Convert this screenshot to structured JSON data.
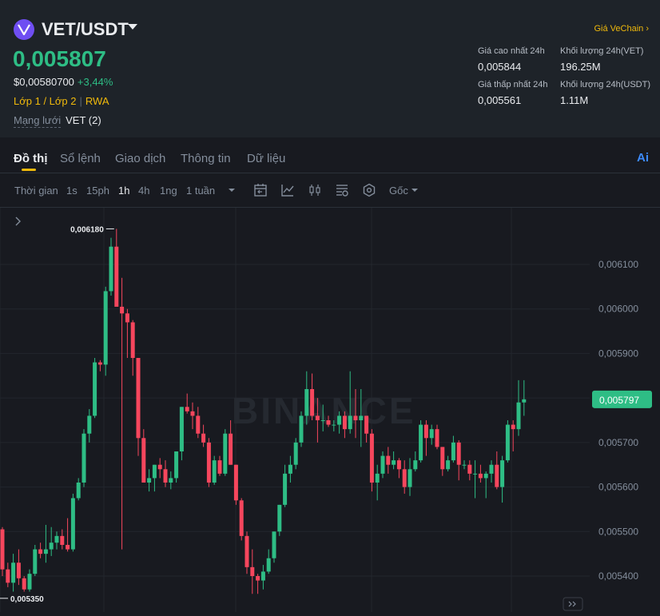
{
  "header": {
    "pair": "VET/USDT",
    "price": "0,005807",
    "usd_price": "$0,00580700",
    "change": "+3,44%",
    "tag1": "Lớp 1 / Lớp 2",
    "tag2": "RWA",
    "network_label": "Mạng lưới",
    "network_value": "VET (2)",
    "vechain_link": "Giá VeChain"
  },
  "stats": {
    "high_label": "Giá cao nhất 24h",
    "high_value": "0,005844",
    "low_label": "Giá thấp nhất 24h",
    "low_value": "0,005561",
    "vol_vet_label": "Khối lượng 24h(VET)",
    "vol_vet_value": "196.25M",
    "vol_usdt_label": "Khối lượng 24h(USDT)",
    "vol_usdt_value": "1.11M"
  },
  "tabs": [
    "Đồ thị",
    "Sổ lệnh",
    "Giao dịch",
    "Thông tin",
    "Dữ liệu"
  ],
  "ai_label": "Ai",
  "toolbar": {
    "time_label": "Thời gian",
    "intervals": [
      "1s",
      "15ph",
      "1h",
      "4h",
      "1ng",
      "1 tuần"
    ],
    "active_interval": "1h",
    "price_type": "Gốc"
  },
  "colors": {
    "up": "#2ebd85",
    "down": "#f6465d",
    "accent": "#f0b90b",
    "ai": "#3d8bfd"
  },
  "chart": {
    "watermark": "BINANCE",
    "y_ticks": [
      "0,006100",
      "0,006000",
      "0,005900",
      "0,005800",
      "0,005700",
      "0,005600",
      "0,005500",
      "0,005400"
    ],
    "y_tick_values": [
      0.0061,
      0.006,
      0.0059,
      0.0058,
      0.0057,
      0.0056,
      0.0055,
      0.0054
    ],
    "current_price": "0,005797",
    "current_value": 0.005797,
    "high_label": "0,006180",
    "low_label": "0,005350",
    "high_value": 0.00618,
    "low_value": 0.00535,
    "candles": [
      [
        0.005505,
        0.00551,
        0.0054,
        0.005415
      ],
      [
        0.005415,
        0.00543,
        0.005375,
        0.005385
      ],
      [
        0.005385,
        0.00545,
        0.005365,
        0.00543
      ],
      [
        0.00543,
        0.00546,
        0.00538,
        0.005395
      ],
      [
        0.005395,
        0.0054,
        0.005365,
        0.00537
      ],
      [
        0.00537,
        0.005415,
        0.005365,
        0.005405
      ],
      [
        0.005405,
        0.00547,
        0.0054,
        0.00546
      ],
      [
        0.00546,
        0.005475,
        0.00544,
        0.00545
      ],
      [
        0.00545,
        0.005515,
        0.00543,
        0.00546
      ],
      [
        0.00546,
        0.00551,
        0.005445,
        0.005475
      ],
      [
        0.005475,
        0.0055,
        0.00546,
        0.00549
      ],
      [
        0.00549,
        0.005505,
        0.00546,
        0.00547
      ],
      [
        0.00547,
        0.00553,
        0.005455,
        0.00546
      ],
      [
        0.00546,
        0.005585,
        0.005455,
        0.005575
      ],
      [
        0.005575,
        0.00562,
        0.00557,
        0.00561
      ],
      [
        0.00561,
        0.00573,
        0.0056,
        0.00572
      ],
      [
        0.00572,
        0.005775,
        0.0057,
        0.00576
      ],
      [
        0.00576,
        0.00589,
        0.005755,
        0.00588
      ],
      [
        0.00588,
        0.005885,
        0.00586,
        0.005875
      ],
      [
        0.005875,
        0.00605,
        0.00585,
        0.00604
      ],
      [
        0.00604,
        0.00616,
        0.00603,
        0.00614
      ],
      [
        0.00614,
        0.00618,
        0.00605,
        0.006005
      ],
      [
        0.006005,
        0.00607,
        0.00546,
        0.00599
      ],
      [
        0.00599,
        0.006,
        0.00589,
        0.00597
      ],
      [
        0.00597,
        0.005975,
        0.00585,
        0.00589
      ],
      [
        0.00589,
        0.00589,
        0.00567,
        0.00571
      ],
      [
        0.00571,
        0.00573,
        0.00561,
        0.00561
      ],
      [
        0.00561,
        0.00564,
        0.00559,
        0.00562
      ],
      [
        0.00562,
        0.00565,
        0.00559,
        0.00565
      ],
      [
        0.00565,
        0.005665,
        0.00562,
        0.00564
      ],
      [
        0.00564,
        0.00566,
        0.0056,
        0.00561
      ],
      [
        0.00561,
        0.005635,
        0.005595,
        0.00562
      ],
      [
        0.00562,
        0.00568,
        0.00561,
        0.00568
      ],
      [
        0.00568,
        0.00578,
        0.00566,
        0.00578
      ],
      [
        0.00578,
        0.00581,
        0.005765,
        0.00577
      ],
      [
        0.00577,
        0.00579,
        0.00573,
        0.00576
      ],
      [
        0.00576,
        0.00578,
        0.00571,
        0.00572
      ],
      [
        0.00572,
        0.00574,
        0.00569,
        0.0057
      ],
      [
        0.0057,
        0.00571,
        0.0056,
        0.00561
      ],
      [
        0.00561,
        0.00567,
        0.005605,
        0.00566
      ],
      [
        0.00566,
        0.00567,
        0.005625,
        0.00563
      ],
      [
        0.00563,
        0.00573,
        0.005625,
        0.00572
      ],
      [
        0.00572,
        0.00575,
        0.00565,
        0.00565
      ],
      [
        0.00565,
        0.00565,
        0.00556,
        0.00557
      ],
      [
        0.00557,
        0.005575,
        0.00548,
        0.00549
      ],
      [
        0.00549,
        0.0055,
        0.005405,
        0.00542
      ],
      [
        0.00542,
        0.00546,
        0.00536,
        0.0054
      ],
      [
        0.0054,
        0.005405,
        0.00536,
        0.00539
      ],
      [
        0.00539,
        0.005425,
        0.00537,
        0.00541
      ],
      [
        0.00541,
        0.00546,
        0.005405,
        0.00544
      ],
      [
        0.00544,
        0.0055,
        0.00543,
        0.0055
      ],
      [
        0.0055,
        0.00556,
        0.00549,
        0.00556
      ],
      [
        0.00556,
        0.00565,
        0.005555,
        0.00563
      ],
      [
        0.00563,
        0.00567,
        0.00561,
        0.00565
      ],
      [
        0.00565,
        0.00571,
        0.00564,
        0.0057
      ],
      [
        0.0057,
        0.00577,
        0.00569,
        0.00576
      ],
      [
        0.00576,
        0.00586,
        0.00574,
        0.00582
      ],
      [
        0.00582,
        0.005855,
        0.00575,
        0.00576
      ],
      [
        0.00576,
        0.0058,
        0.0057,
        0.00575
      ],
      [
        0.00575,
        0.005785,
        0.005725,
        0.00575
      ],
      [
        0.00575,
        0.00576,
        0.005735,
        0.00574
      ],
      [
        0.00574,
        0.00575,
        0.005725,
        0.00574
      ],
      [
        0.00574,
        0.00577,
        0.00572,
        0.00576
      ],
      [
        0.00576,
        0.00577,
        0.00571,
        0.00573
      ],
      [
        0.00573,
        0.00586,
        0.00572,
        0.00576
      ],
      [
        0.00576,
        0.00582,
        0.00571,
        0.00575
      ],
      [
        0.00575,
        0.00582,
        0.00569,
        0.00576
      ],
      [
        0.00576,
        0.00576,
        0.0057,
        0.00572
      ],
      [
        0.00572,
        0.00573,
        0.00559,
        0.00561
      ],
      [
        0.00561,
        0.00565,
        0.00557,
        0.00563
      ],
      [
        0.00563,
        0.00568,
        0.00562,
        0.00567
      ],
      [
        0.00567,
        0.00569,
        0.00563,
        0.00565
      ],
      [
        0.00565,
        0.00568,
        0.00564,
        0.00566
      ],
      [
        0.00566,
        0.005665,
        0.00562,
        0.00564
      ],
      [
        0.00564,
        0.00566,
        0.005585,
        0.0056
      ],
      [
        0.0056,
        0.005665,
        0.00558,
        0.00564
      ],
      [
        0.00564,
        0.00568,
        0.005635,
        0.00566
      ],
      [
        0.00566,
        0.00575,
        0.005655,
        0.00574
      ],
      [
        0.00574,
        0.00575,
        0.00567,
        0.00571
      ],
      [
        0.00571,
        0.00574,
        0.005695,
        0.00573
      ],
      [
        0.00573,
        0.00574,
        0.005685,
        0.00569
      ],
      [
        0.00569,
        0.00569,
        0.005625,
        0.00564
      ],
      [
        0.00564,
        0.00567,
        0.005635,
        0.00566
      ],
      [
        0.00566,
        0.005715,
        0.005655,
        0.0057
      ],
      [
        0.0057,
        0.005705,
        0.005615,
        0.00565
      ],
      [
        0.00565,
        0.00566,
        0.00564,
        0.00565
      ],
      [
        0.00565,
        0.00566,
        0.005615,
        0.00563
      ],
      [
        0.00563,
        0.00566,
        0.005575,
        0.00563
      ],
      [
        0.00563,
        0.00565,
        0.00561,
        0.00562
      ],
      [
        0.00562,
        0.005635,
        0.005575,
        0.00563
      ],
      [
        0.00563,
        0.00566,
        0.00561,
        0.00565
      ],
      [
        0.00565,
        0.00568,
        0.005595,
        0.0056
      ],
      [
        0.0056,
        0.00567,
        0.005565,
        0.00566
      ],
      [
        0.00566,
        0.00575,
        0.005655,
        0.00574
      ],
      [
        0.00574,
        0.00575,
        0.00568,
        0.00573
      ],
      [
        0.00573,
        0.00584,
        0.005715,
        0.00579
      ],
      [
        0.00579,
        0.00584,
        0.00576,
        0.005797
      ]
    ]
  }
}
